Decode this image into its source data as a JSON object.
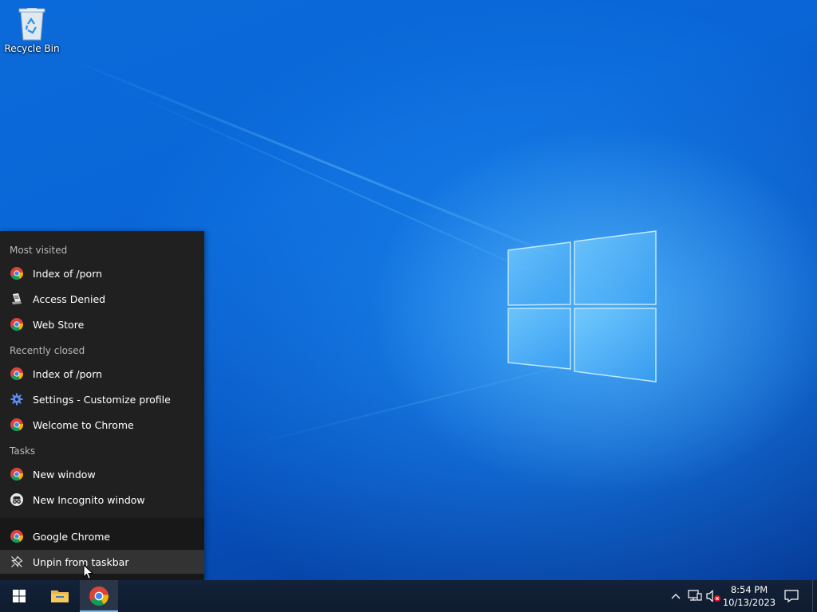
{
  "desktop": {
    "recycle_bin_label": "Recycle Bin"
  },
  "jumplist": {
    "sections": {
      "most_visited": "Most visited",
      "recently_closed": "Recently closed",
      "tasks": "Tasks"
    },
    "most_visited": [
      {
        "label": "Index of /porn",
        "icon": "chrome-icon"
      },
      {
        "label": "Access Denied",
        "icon": "page-icon"
      },
      {
        "label": "Web Store",
        "icon": "chrome-icon"
      }
    ],
    "recently_closed": [
      {
        "label": "Index of /porn",
        "icon": "chrome-icon"
      },
      {
        "label": "Settings - Customize profile",
        "icon": "gear-icon"
      },
      {
        "label": "Welcome to Chrome",
        "icon": "chrome-icon"
      }
    ],
    "tasks": [
      {
        "label": "New window",
        "icon": "chrome-icon"
      },
      {
        "label": "New Incognito window",
        "icon": "incognito-icon"
      }
    ],
    "app": {
      "label": "Google Chrome",
      "icon": "chrome-icon"
    },
    "unpin": {
      "label": "Unpin from taskbar",
      "icon": "unpin-icon"
    }
  },
  "taskbar": {
    "start_icon": "windows-start-icon",
    "pinned": [
      "file-explorer-icon",
      "chrome-icon"
    ],
    "tray": {
      "time": "8:54 PM",
      "date": "10/13/2023",
      "icons": [
        "chevron-up-icon",
        "network-icon",
        "volume-muted-icon",
        "notification-icon"
      ]
    }
  },
  "colors": {
    "jumplist_bg": "#202020",
    "jumplist_bottom_bg": "#181818",
    "hover": "#333333",
    "taskbar_bg": "#101a2a",
    "accent": "#76b9ed"
  }
}
